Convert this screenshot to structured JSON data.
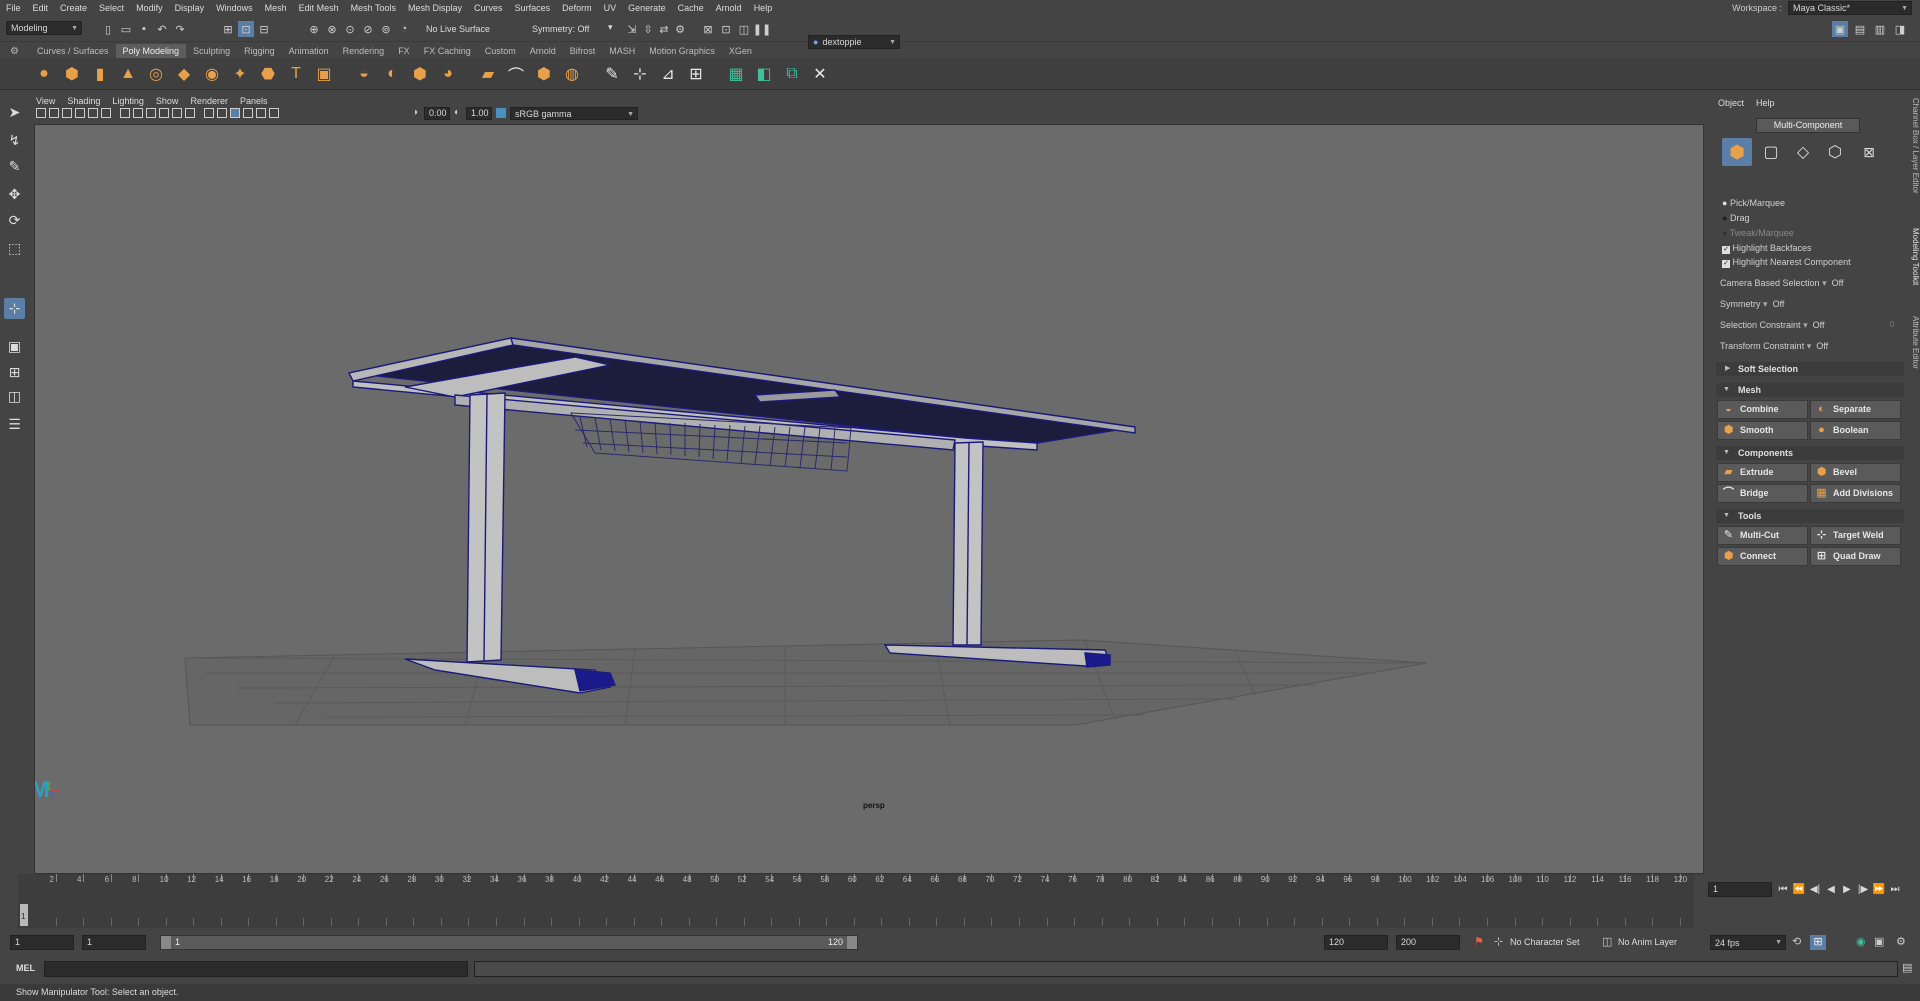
{
  "menubar": {
    "items": [
      "File",
      "Edit",
      "Create",
      "Select",
      "Modify",
      "Display",
      "Windows",
      "Mesh",
      "Edit Mesh",
      "Mesh Tools",
      "Mesh Display",
      "Curves",
      "Surfaces",
      "Deform",
      "UV",
      "Generate",
      "Cache",
      "Arnold",
      "Help"
    ],
    "workspace_label": "Workspace :",
    "workspace_value": "Maya Classic*"
  },
  "statusline": {
    "mode": "Modeling",
    "live_surface": "No Live Surface",
    "symmetry": "Symmetry: Off",
    "user": "dextoppie"
  },
  "shelf": {
    "tabs": [
      "Curves / Surfaces",
      "Poly Modeling",
      "Sculpting",
      "Rigging",
      "Animation",
      "Rendering",
      "FX",
      "FX Caching",
      "Custom",
      "Arnold",
      "Bifrost",
      "MASH",
      "Motion Graphics",
      "XGen"
    ],
    "active_tab": "Poly Modeling",
    "icons": [
      "sphere-icon",
      "cube-icon",
      "cylinder-icon",
      "cone-icon",
      "torus-icon",
      "plane-icon",
      "disc-icon",
      "platonic-icon",
      "superellipse-icon",
      "type-icon",
      "svg-icon",
      "combine-icon",
      "separate-icon",
      "smooth-icon",
      "boolean-icon",
      "extrude-icon",
      "bridge-icon",
      "bevel-icon",
      "fill-hole-icon",
      "multi-cut-icon",
      "target-weld-icon",
      "connect-icon",
      "quad-draw-icon",
      "uv-icon",
      "unfold-icon",
      "layout-icon",
      "transfer-icon"
    ]
  },
  "viewport": {
    "menu": [
      "View",
      "Shading",
      "Lighting",
      "Show",
      "Renderer",
      "Panels"
    ],
    "exposure": "0.00",
    "gamma": "1.00",
    "color_space": "sRGB gamma",
    "camera": "persp"
  },
  "modeling_toolkit": {
    "menu": [
      "Object",
      "Help"
    ],
    "mode_button": "Multi-Component",
    "pick_modes": [
      "Pick/Marquee",
      "Drag",
      "Tweak/Marquee"
    ],
    "checks": [
      "Highlight Backfaces",
      "Highlight Nearest Component"
    ],
    "camera_based_selection_label": "Camera Based Selection",
    "camera_based_selection_value": "Off",
    "symmetry_label": "Symmetry",
    "symmetry_value": "Off",
    "selection_constraint_label": "Selection Constraint",
    "selection_constraint_value": "Off",
    "selection_constraint_num": "0",
    "transform_constraint_label": "Transform Constraint",
    "transform_constraint_value": "Off",
    "soft_selection": "Soft Selection",
    "sections": {
      "mesh": {
        "title": "Mesh",
        "buttons": [
          "Combine",
          "Separate",
          "Smooth",
          "Boolean"
        ]
      },
      "components": {
        "title": "Components",
        "buttons": [
          "Extrude",
          "Bevel",
          "Bridge",
          "Add Divisions"
        ]
      },
      "tools": {
        "title": "Tools",
        "buttons": [
          "Multi-Cut",
          "Target Weld",
          "Connect",
          "Quad Draw"
        ]
      }
    }
  },
  "side_tabs": [
    "Channel Box / Layer Editor",
    "Modeling Toolkit",
    "Attribute Editor"
  ],
  "timeline": {
    "ticks": [
      "2",
      "4",
      "6",
      "8",
      "10",
      "12",
      "14",
      "16",
      "18",
      "20",
      "22",
      "24",
      "26",
      "28",
      "30",
      "32",
      "34",
      "36",
      "38",
      "40",
      "42",
      "44",
      "46",
      "48",
      "50",
      "52",
      "54",
      "56",
      "58",
      "60",
      "62",
      "64",
      "66",
      "68",
      "70",
      "72",
      "74",
      "76",
      "78",
      "80",
      "82",
      "84",
      "86",
      "88",
      "90",
      "92",
      "94",
      "96",
      "98",
      "100",
      "102",
      "104",
      "106",
      "108",
      "110",
      "112",
      "114",
      "116",
      "118",
      "120"
    ],
    "current_frame_marker": "1",
    "current_frame_field": "1"
  },
  "range": {
    "start": "1",
    "playback_start": "1",
    "slider_start": "1",
    "slider_end": "120",
    "playback_end": "120",
    "end": "200",
    "character_set": "No Character Set",
    "anim_layer": "No Anim Layer",
    "fps": "24 fps"
  },
  "command_line": {
    "label": "MEL"
  },
  "help_line": {
    "text": "Show Manipulator Tool: Select an object."
  }
}
